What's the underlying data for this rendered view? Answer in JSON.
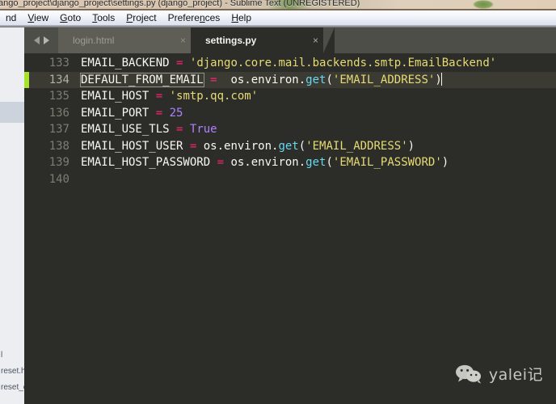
{
  "window": {
    "title": "ango_project\\django_project\\settings.py (django_project) - Sublime Text (UNREGISTERED)"
  },
  "menubar": {
    "items": [
      {
        "label": "nd",
        "accel": ""
      },
      {
        "label": "View",
        "accel": "V"
      },
      {
        "label": "Goto",
        "accel": "G"
      },
      {
        "label": "Tools",
        "accel": "T"
      },
      {
        "label": "Project",
        "accel": "P"
      },
      {
        "label": "Preferences",
        "accel": "n"
      },
      {
        "label": "Help",
        "accel": "H"
      }
    ]
  },
  "tabbar": {
    "nav_prev": "prev-file-arrow",
    "nav_next": "next-file-arrow",
    "close_glyph": "×",
    "tabs": [
      {
        "label": "login.html",
        "active": false
      },
      {
        "label": "settings.py",
        "active": true
      }
    ]
  },
  "editor": {
    "active_line": 134,
    "lines": [
      {
        "number": "133",
        "tokens": [
          {
            "t": "EMAIL_BACKEND ",
            "c": "plain"
          },
          {
            "t": "=",
            "c": "op"
          },
          {
            "t": " ",
            "c": "plain"
          },
          {
            "t": "'django.core.mail.backends.smtp.EmailBackend'",
            "c": "str"
          }
        ]
      },
      {
        "number": "134",
        "tokens": [
          {
            "t": "DEFAULT_FROM_EMAIL",
            "c": "plain",
            "box": true
          },
          {
            "t": " ",
            "c": "plain"
          },
          {
            "t": "=",
            "c": "op"
          },
          {
            "t": "  ",
            "c": "plain"
          },
          {
            "t": "os.environ.",
            "c": "plain"
          },
          {
            "t": "get",
            "c": "fn"
          },
          {
            "t": "(",
            "c": "plain"
          },
          {
            "t": "'EMAIL_ADDRESS'",
            "c": "str"
          },
          {
            "t": ")",
            "c": "plain"
          },
          {
            "t": "",
            "c": "caret"
          }
        ]
      },
      {
        "number": "135",
        "tokens": [
          {
            "t": "EMAIL_HOST ",
            "c": "plain"
          },
          {
            "t": "=",
            "c": "op"
          },
          {
            "t": " ",
            "c": "plain"
          },
          {
            "t": "'smtp.qq.com'",
            "c": "str"
          }
        ]
      },
      {
        "number": "136",
        "tokens": [
          {
            "t": "EMAIL_PORT ",
            "c": "plain"
          },
          {
            "t": "=",
            "c": "op"
          },
          {
            "t": " ",
            "c": "plain"
          },
          {
            "t": "25",
            "c": "num"
          }
        ]
      },
      {
        "number": "137",
        "tokens": [
          {
            "t": "EMAIL_USE_TLS ",
            "c": "plain"
          },
          {
            "t": "=",
            "c": "op"
          },
          {
            "t": " ",
            "c": "plain"
          },
          {
            "t": "True",
            "c": "num"
          }
        ]
      },
      {
        "number": "138",
        "tokens": [
          {
            "t": "EMAIL_HOST_USER ",
            "c": "plain"
          },
          {
            "t": "=",
            "c": "op"
          },
          {
            "t": " os.environ.",
            "c": "plain"
          },
          {
            "t": "get",
            "c": "fn"
          },
          {
            "t": "(",
            "c": "plain"
          },
          {
            "t": "'EMAIL_ADDRESS'",
            "c": "str"
          },
          {
            "t": ")",
            "c": "plain"
          }
        ]
      },
      {
        "number": "139",
        "tokens": [
          {
            "t": "EMAIL_HOST_PASSWORD ",
            "c": "plain"
          },
          {
            "t": "=",
            "c": "op"
          },
          {
            "t": " os.environ.",
            "c": "plain"
          },
          {
            "t": "get",
            "c": "fn"
          },
          {
            "t": "(",
            "c": "plain"
          },
          {
            "t": "'EMAIL_PASSWORD'",
            "c": "str"
          },
          {
            "t": ")",
            "c": "plain"
          }
        ]
      },
      {
        "number": "140",
        "tokens": []
      }
    ]
  },
  "background": {
    "file_list": [
      "l",
      "reset.h",
      "reset_c"
    ]
  },
  "watermark": {
    "icon": "wechat-icon",
    "text": "yalei记"
  },
  "colors": {
    "editor_bg": "#2c2c28",
    "active_line": "#3b3b33",
    "gutter_marker": "#a6e22e",
    "string": "#e6db74",
    "operator": "#f92672",
    "number": "#ae81ff",
    "function": "#66d9ef",
    "text": "#f8f8f2",
    "tab_bar": "#4e4e48",
    "tab_inactive": "#5e5e57"
  }
}
